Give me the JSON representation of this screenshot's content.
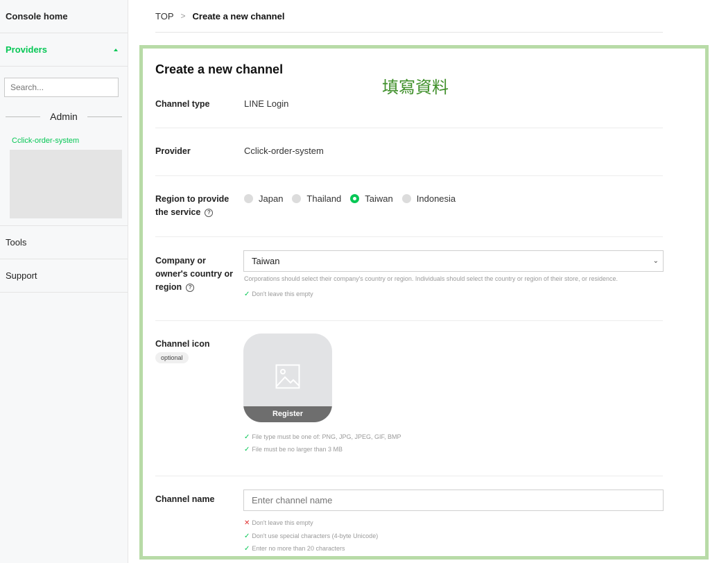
{
  "sidebar": {
    "console_home": "Console home",
    "providers": "Providers",
    "search_placeholder": "Search...",
    "admin_label": "Admin",
    "provider_link": "Cclick-order-system",
    "tools": "Tools",
    "support": "Support"
  },
  "breadcrumb": {
    "top": "TOP",
    "separator": ">",
    "current": "Create a new channel"
  },
  "page": {
    "title": "Create a new channel",
    "annotation": "填寫資料"
  },
  "form": {
    "channel_type": {
      "label": "Channel type",
      "value": "LINE Login"
    },
    "provider": {
      "label": "Provider",
      "value": "Cclick-order-system"
    },
    "region": {
      "label_line1": "Region to provide",
      "label_line2": "the service",
      "help": "?",
      "options": [
        "Japan",
        "Thailand",
        "Taiwan",
        "Indonesia"
      ],
      "selected": "Taiwan"
    },
    "company_country": {
      "label_line1": "Company or",
      "label_line2": "owner's country or",
      "label_line3": "region",
      "help": "?",
      "value": "Taiwan",
      "chevron": "⌄",
      "hint": "Corporations should select their company's country or region. Individuals should select the country or region of their store, or residence.",
      "validation": "Don't leave this empty"
    },
    "channel_icon": {
      "label": "Channel icon",
      "tag": "optional",
      "register": "Register",
      "rule1": "File type must be one of: PNG, JPG, JPEG, GIF, BMP",
      "rule2": "File must be no larger than 3 MB"
    },
    "channel_name": {
      "label": "Channel name",
      "placeholder": "Enter channel name",
      "rule1": "Don't leave this empty",
      "rule2": "Don't use special characters (4-byte Unicode)",
      "rule3": "Enter no more than 20 characters"
    }
  },
  "colors": {
    "accent": "#06c755",
    "annotation": "#3f8f2a",
    "frame": "#b8dba7",
    "error": "#e03131"
  },
  "icons": {
    "check": "✓",
    "cross": "✕"
  }
}
